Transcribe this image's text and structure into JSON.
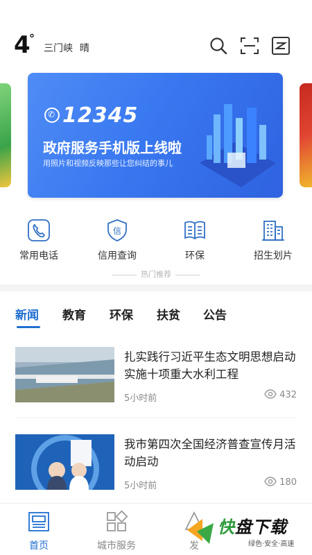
{
  "header": {
    "temperature": "4",
    "degree_symbol": "°",
    "city": "三门峡",
    "weather": "晴",
    "icons": [
      "search-icon",
      "scan-icon",
      "news-feed-icon"
    ]
  },
  "banner": {
    "number": "12345",
    "title": "政府服务手机版上线啦",
    "subtitle": "用照片和视频反映那些让您纠结的事儿"
  },
  "quick_services": [
    {
      "label": "常用电话",
      "icon": "phone-icon"
    },
    {
      "label": "信用查询",
      "icon": "credit-shield-icon"
    },
    {
      "label": "环保",
      "icon": "book-icon"
    },
    {
      "label": "招生划片",
      "icon": "building-icon"
    }
  ],
  "hot_recommend": "热门推荐",
  "tabs": [
    {
      "label": "新闻",
      "active": true
    },
    {
      "label": "教育",
      "active": false
    },
    {
      "label": "环保",
      "active": false
    },
    {
      "label": "扶贫",
      "active": false
    },
    {
      "label": "公告",
      "active": false
    }
  ],
  "news": [
    {
      "title": "扎实践行习近平生态文明思想启动实施十项重大水利工程",
      "time": "5小时前",
      "views": "432"
    },
    {
      "title": "我市第四次全国经济普查宣传月活动启动",
      "time": "5小时前",
      "views": "180"
    }
  ],
  "bottom_nav": [
    {
      "label": "首页",
      "icon": "home-icon",
      "active": true
    },
    {
      "label": "城市服务",
      "icon": "grid-icon",
      "active": false
    },
    {
      "label": "发",
      "icon": "post-icon",
      "active": false
    }
  ],
  "watermark": {
    "brand_green": "快",
    "brand_black": "盘下载",
    "tagline": "绿色·安全·高速"
  },
  "colors": {
    "accent": "#1f6fd1",
    "banner": "#3978f0",
    "icon_blue": "#2f6fc4"
  }
}
